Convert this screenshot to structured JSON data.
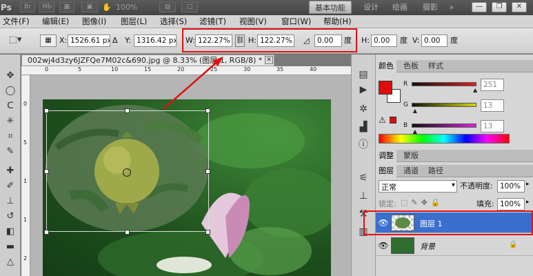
{
  "app": {
    "logo": "Ps",
    "bar_icons": [
      "Br",
      "Mb"
    ],
    "zoom": "100%",
    "workspaces": [
      "基本功能",
      "设计",
      "绘画",
      "摄影"
    ],
    "workspace_more": "»"
  },
  "menu": [
    "文件(F)",
    "编辑(E)",
    "图像(I)",
    "图层(L)",
    "选择(S)",
    "滤镜(T)",
    "视图(V)",
    "窗口(W)",
    "帮助(H)"
  ],
  "options": {
    "x_label": "X:",
    "x_value": "1526.61 px",
    "y_label": "Y:",
    "y_value": "1316.42 px",
    "w_label": "W:",
    "w_value": "122.27%",
    "h_label": "H:",
    "h_value": "122.27%",
    "angle_value": "0.00",
    "angle_unit": "度",
    "hskew_label": "H:",
    "hskew_value": "0.00",
    "hskew_unit": "度",
    "vskew_label": "V:",
    "vskew_value": "0.00",
    "vskew_unit": "度"
  },
  "document": {
    "tab_title": "002wj4d3zy6JZFQe7M02c&690.jpg @ 8.33% (图层 1, RGB/8) *",
    "ruler_h": [
      "0",
      "5",
      "10",
      "15",
      "20",
      "25",
      "30",
      "35",
      "40"
    ],
    "ruler_v": [
      "0",
      "5",
      "1",
      "1",
      "2"
    ]
  },
  "color_panel": {
    "tabs": [
      "颜色",
      "色板",
      "样式"
    ],
    "channels": [
      {
        "label": "R",
        "value": "251",
        "color": "#e02020",
        "level": 0.98
      },
      {
        "label": "G",
        "value": "13",
        "color": "#d8d800",
        "level": 0.05
      },
      {
        "label": "B",
        "value": "13",
        "color": "#e020e0",
        "level": 0.05
      }
    ],
    "foreground": "#e00d0d"
  },
  "adjust_panel": {
    "tabs": [
      "调整",
      "蒙版"
    ]
  },
  "layers_panel": {
    "tabs": [
      "图层",
      "通道",
      "路径"
    ],
    "blend_mode": "正常",
    "opacity_label": "不透明度:",
    "opacity_value": "100%",
    "lock_label": "锁定:",
    "fill_label": "填充:",
    "fill_value": "100%",
    "layers": [
      {
        "name": "图层 1",
        "selected": true
      },
      {
        "name": "背景",
        "selected": false
      }
    ]
  },
  "colors": {
    "highlight": "#e01010",
    "selection": "#3a6fd0"
  }
}
